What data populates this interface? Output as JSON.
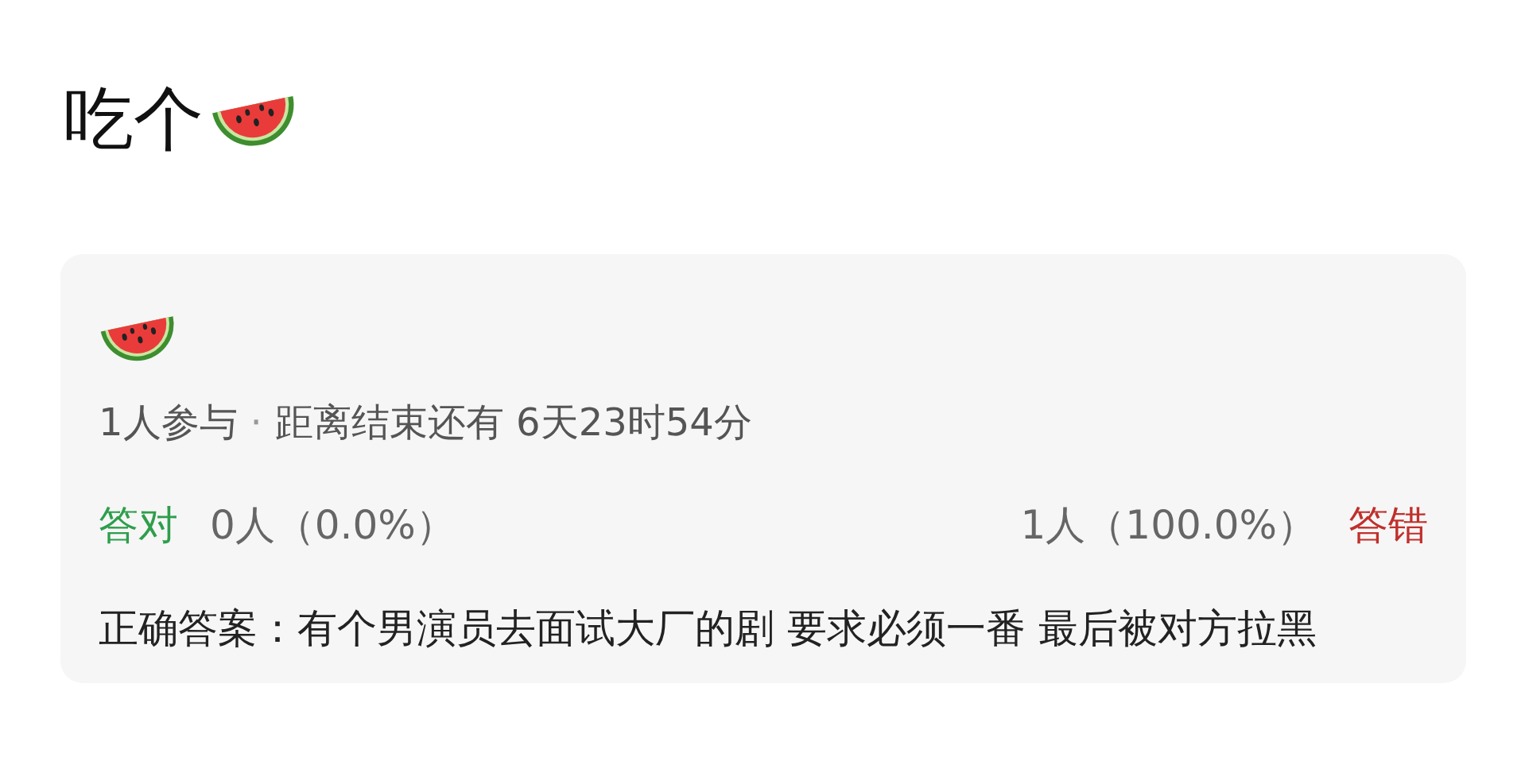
{
  "post": {
    "title": "吃个"
  },
  "poll": {
    "participants": "1人参与",
    "separator": "·",
    "countdown": "距离结束还有 6天23时54分",
    "options": [
      {
        "kind": "correct",
        "label": "答对",
        "result": "0人（0.0%）"
      },
      {
        "kind": "wrong",
        "label": "答错",
        "result": "1人（100.0%）"
      }
    ],
    "answer": "正确答案：有个男演员去面试大厂的剧 要求必须一番 最后被对方拉黑"
  }
}
